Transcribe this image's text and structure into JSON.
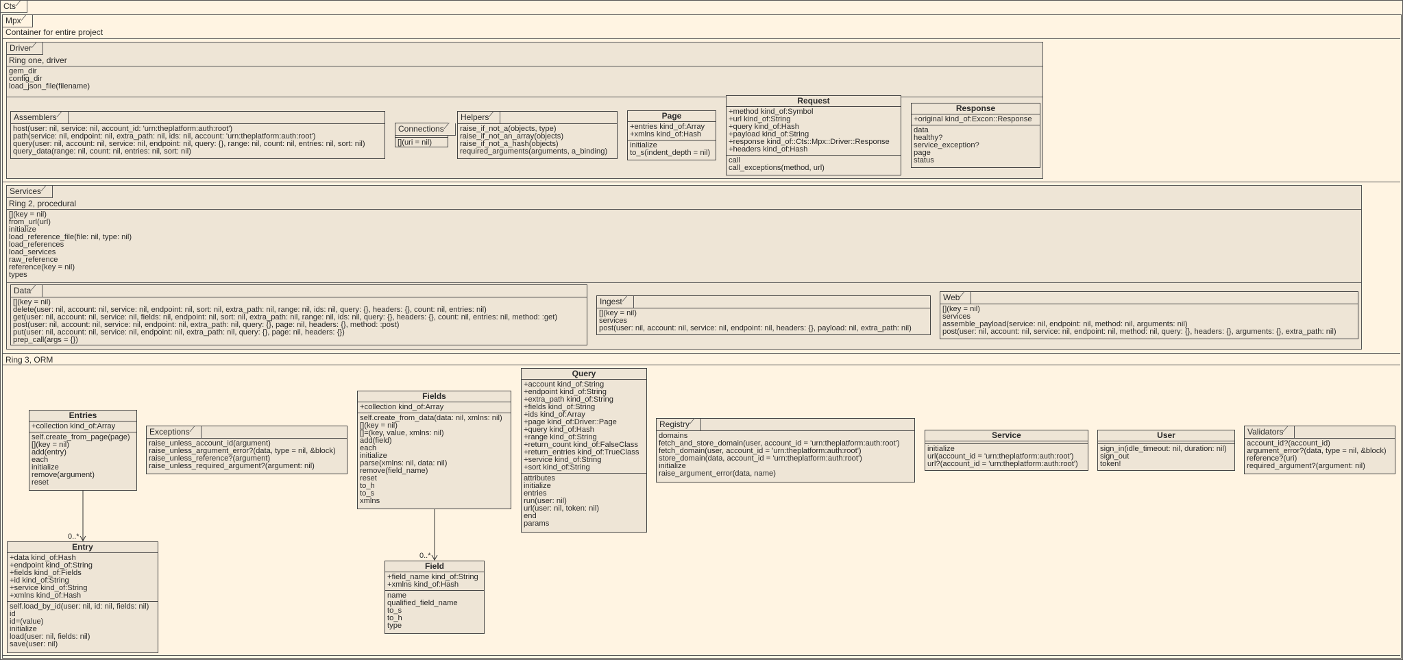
{
  "cts": {
    "label": "Cts"
  },
  "mpx": {
    "label": "Mpx",
    "description": "Container for entire project"
  },
  "driver": {
    "label": "Driver",
    "description": "Ring one, driver",
    "methods": [
      "gem_dir",
      "config_dir",
      "load_json_file(filename)"
    ],
    "assemblers": {
      "label": "Assemblers",
      "methods": [
        "host(user: nil, service: nil, account_id: 'urn:theplatform:auth:root')",
        "path(service: nil, endpoint: nil, extra_path: nil, ids: nil, account: 'urn:theplatform:auth:root')",
        "query(user: nil, account: nil, service: nil, endpoint: nil, query: {}, range: nil, count: nil, entries: nil, sort: nil)",
        "query_data(range: nil, count: nil, entries: nil, sort: nil)"
      ]
    },
    "connections": {
      "label": "Connections",
      "methods": [
        "[](uri = nil)"
      ]
    },
    "helpers": {
      "label": "Helpers",
      "methods": [
        "raise_if_not_a(objects, type)",
        "raise_if_not_an_array(objects)",
        "raise_if_not_a_hash(objects)",
        "required_arguments(arguments, a_binding)"
      ]
    },
    "page": {
      "title": "Page",
      "attributes": [
        "+entries kind_of:Array",
        "+xmlns kind_of:Hash"
      ],
      "methods": [
        "initialize",
        "to_s(indent_depth = nil)"
      ]
    },
    "request": {
      "title": "Request",
      "attributes": [
        "+method kind_of:Symbol",
        "+url kind_of:String",
        "+query kind_of:Hash",
        "+payload kind_of:String",
        "+response kind_of::Cts::Mpx::Driver::Response",
        "+headers kind_of:Hash"
      ],
      "methods": [
        "call",
        "call_exceptions(method, url)"
      ]
    },
    "response": {
      "title": "Response",
      "attributes": [
        "+original kind_of:Excon::Response"
      ],
      "methods": [
        "data",
        "healthy?",
        "service_exception?",
        "page",
        "status"
      ]
    }
  },
  "services": {
    "label": "Services",
    "description": "Ring 2, procedural",
    "methods": [
      "[](key = nil)",
      "from_url(url)",
      "initialize",
      "load_reference_file(file: nil, type: nil)",
      "load_references",
      "load_services",
      "raw_reference",
      "reference(key = nil)",
      "types"
    ],
    "data": {
      "label": "Data",
      "methods": [
        "[](key = nil)",
        "delete(user: nil, account: nil, service: nil, endpoint: nil, sort: nil, extra_path: nil, range: nil, ids: nil, query: {}, headers: {}, count: nil, entries: nil)",
        "get(user: nil, account: nil, service: nil, fields: nil, endpoint: nil, sort: nil, extra_path: nil, range: nil, ids: nil, query: {}, headers: {}, count: nil, entries: nil, method: :get)",
        "post(user: nil, account: nil, service: nil, endpoint: nil, extra_path: nil, query: {}, page: nil, headers: {}, method: :post)",
        "put(user: nil, account: nil, service: nil, endpoint: nil, extra_path: nil, query: {}, page: nil, headers: {})",
        "prep_call(args = {})"
      ]
    },
    "ingest": {
      "label": "Ingest",
      "methods": [
        "[](key = nil)",
        "services",
        "post(user: nil, account: nil, service: nil, endpoint: nil, headers: {}, payload: nil, extra_path: nil)"
      ]
    },
    "web": {
      "label": "Web",
      "methods": [
        "[](key = nil)",
        "services",
        "assemble_payload(service: nil, endpoint: nil, method: nil, arguments: nil)",
        "post(user: nil, account: nil, service: nil, endpoint: nil, method: nil, query: {}, headers: {}, arguments: {}, extra_path: nil)"
      ]
    }
  },
  "ring3": {
    "label": "Ring 3, ORM",
    "entries": {
      "title": "Entries",
      "attributes": [
        "+collection kind_of:Array"
      ],
      "methods": [
        "self.create_from_page(page)",
        "[](key = nil)",
        "add(entry)",
        "each",
        "initialize",
        "remove(argument)",
        "reset"
      ]
    },
    "exceptions": {
      "label": "Exceptions",
      "methods": [
        "raise_unless_account_id(argument)",
        "raise_unless_argument_error?(data, type = nil, &block)",
        "raise_unless_reference?(argument)",
        "raise_unless_required_argument?(argument: nil)"
      ]
    },
    "fields": {
      "title": "Fields",
      "attributes": [
        "+collection kind_of:Array"
      ],
      "methods": [
        "self.create_from_data(data: nil, xmlns: nil)",
        "[](key = nil)",
        "[]=(key, value, xmlns: nil)",
        "add(field)",
        "each",
        "initialize",
        "parse(xmlns: nil, data: nil)",
        "remove(field_name)",
        "reset",
        "to_h",
        "to_s",
        "xmlns"
      ]
    },
    "query": {
      "title": "Query",
      "attributes": [
        "+account kind_of:String",
        "+endpoint kind_of:String",
        "+extra_path kind_of:String",
        "+fields kind_of:String",
        "+ids kind_of:Array",
        "+page kind_of:Driver::Page",
        "+query kind_of:Hash",
        "+range kind_of:String",
        "+return_count kind_of:FalseClass",
        "+return_entries kind_of:TrueClass",
        "+service kind_of:String",
        "+sort kind_of:String"
      ],
      "methods": [
        "attributes",
        "initialize",
        "entries",
        "run(user: nil)",
        "url(user: nil, token: nil)",
        "end",
        "params"
      ]
    },
    "registry": {
      "label": "Registry",
      "methods": [
        "domains",
        "fetch_and_store_domain(user, account_id = 'urn:theplatform:auth:root')",
        "fetch_domain(user, account_id = 'urn:theplatform:auth:root')",
        "store_domain(data, account_id = 'urn:theplatform:auth:root')",
        "initialize",
        "raise_argument_error(data, name)"
      ]
    },
    "service": {
      "title": "Service",
      "methods": [
        "initialize",
        "url(account_id = 'urn:theplatform:auth:root')",
        "url?(account_id = 'urn:theplatform:auth:root')"
      ]
    },
    "user": {
      "title": "User",
      "methods": [
        "sign_in(idle_timeout: nil, duration: nil)",
        "sign_out",
        "token!"
      ]
    },
    "validators": {
      "label": "Validators",
      "methods": [
        "account_id?(account_id)",
        "argument_error?(data, type = nil, &block)",
        "reference?(uri)",
        "required_argument?(argument: nil)"
      ]
    },
    "entry": {
      "title": "Entry",
      "attributes": [
        "+data kind_of:Hash",
        "+endpoint kind_of:String",
        "+fields kind_of:Fields",
        "+id kind_of:String",
        "+service kind_of:String",
        "+xmlns kind_of:Hash"
      ],
      "methods": [
        "self.load_by_id(user: nil, id: nil, fields: nil)",
        "id",
        "id=(value)",
        "initialize",
        "load(user: nil, fields: nil)",
        "save(user: nil)"
      ]
    },
    "field": {
      "title": "Field",
      "attributes": [
        "+field_name kind_of:String",
        "+xmlns kind_of:Hash"
      ],
      "methods": [
        "name",
        "qualified_field_name",
        "to_s",
        "to_h",
        "type"
      ]
    },
    "entries_entry_multiplicity": "0..*",
    "fields_field_multiplicity": "0..*"
  }
}
